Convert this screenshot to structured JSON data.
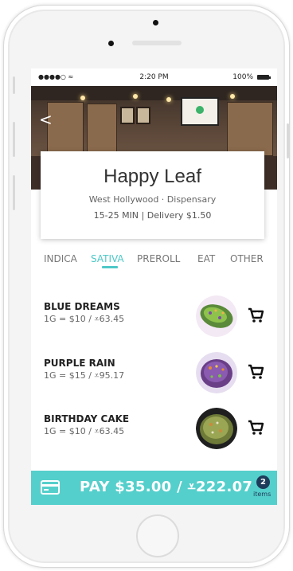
{
  "status_bar": {
    "signal": "●●●●○ ≈",
    "time": "2:20 PM",
    "battery": "100%"
  },
  "header": {
    "back_icon": "chevron-left-icon",
    "back_label": "<"
  },
  "store": {
    "name": "Happy Leaf",
    "location": "West Hollywood · Dispensary",
    "delivery_info": "15-25 MIN | Delivery $1.50"
  },
  "tabs": [
    {
      "label": "INDICA",
      "active": false
    },
    {
      "label": "SATIVA",
      "active": true
    },
    {
      "label": "PREROLL",
      "active": false
    },
    {
      "label": "EAT",
      "active": false
    },
    {
      "label": "OTHER",
      "active": false
    }
  ],
  "products": [
    {
      "name": "BLUE DREAMS",
      "price": "1G = $10 / ⩡63.45",
      "thumb_icon": "bud-icon",
      "cart_icon": "add-to-cart-icon"
    },
    {
      "name": "PURPLE RAIN",
      "price": "1G = $15 / ⩡95.17",
      "thumb_icon": "bud-icon",
      "cart_icon": "add-to-cart-icon"
    },
    {
      "name": "BIRTHDAY CAKE",
      "price": "1G = $10 / ⩡63.45",
      "thumb_icon": "bud-icon",
      "cart_icon": "add-to-cart-icon"
    }
  ],
  "pay_bar": {
    "card_icon": "credit-card-icon",
    "label": "PAY $35.00 / ⩡222.07",
    "item_count": "2",
    "items_label": "items"
  },
  "colors": {
    "accent": "#4ec8c8",
    "pay_bar": "#55cfcb",
    "badge": "#1e3b5b"
  }
}
